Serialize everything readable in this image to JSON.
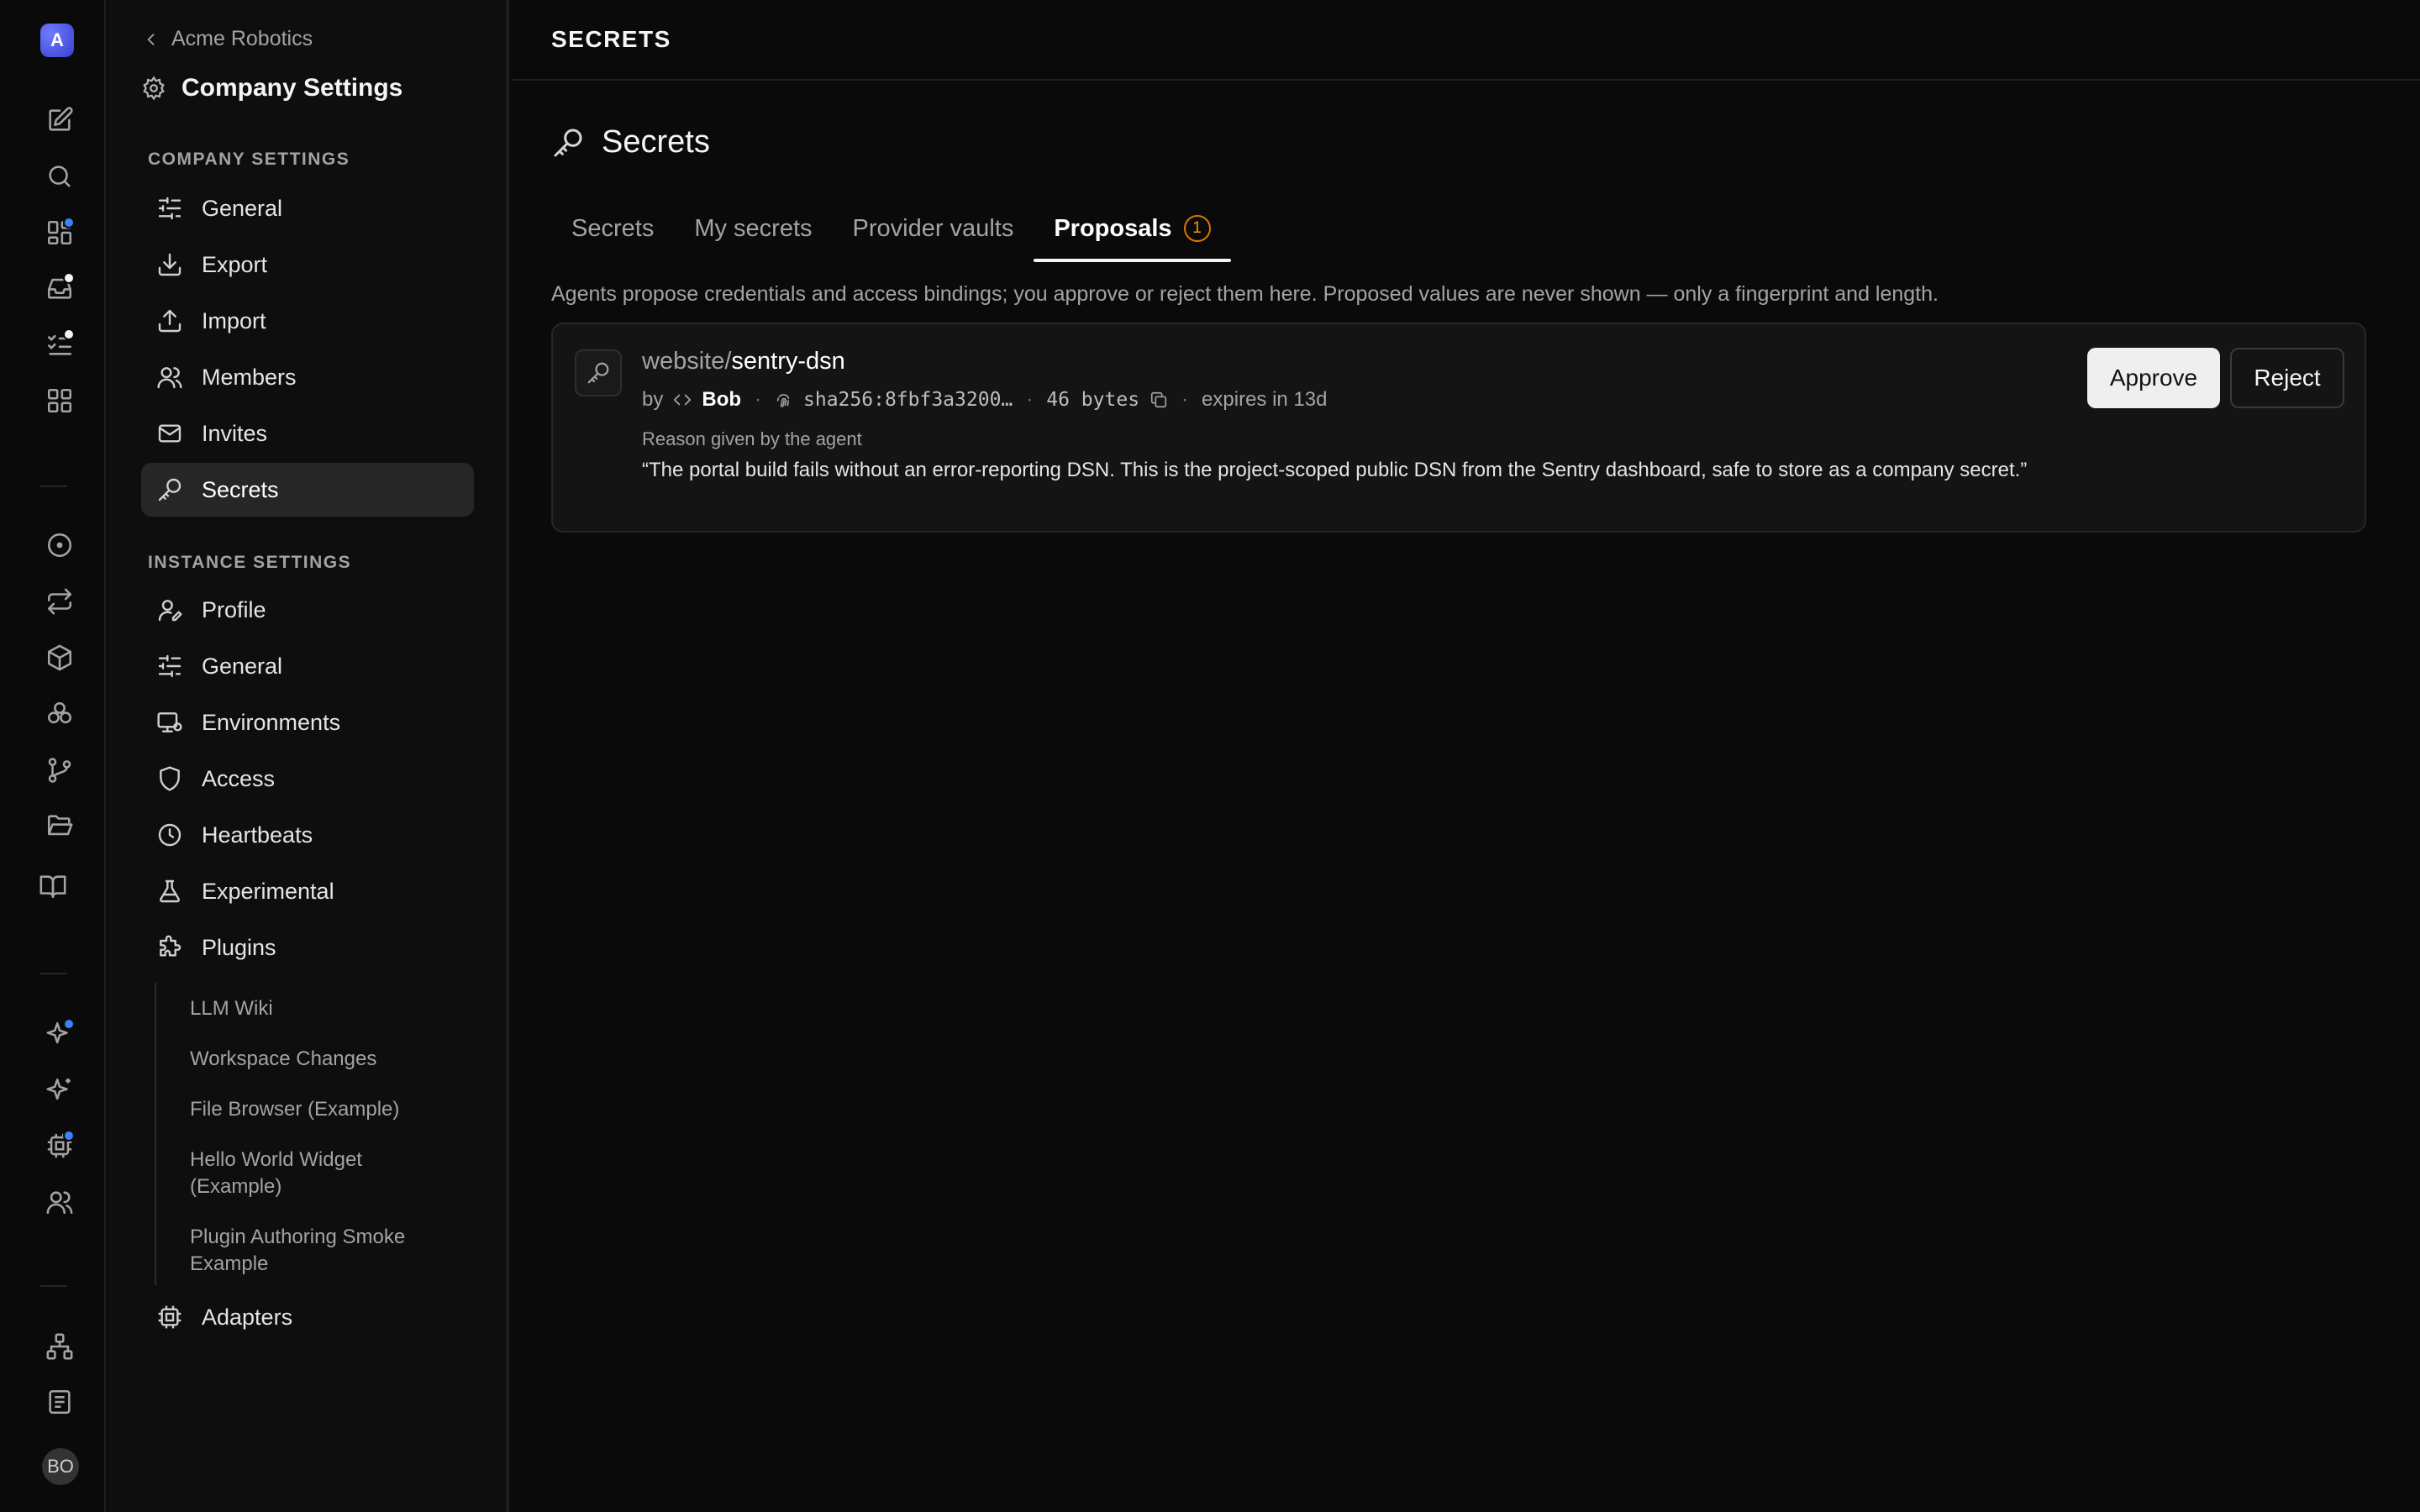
{
  "rail": {
    "logo_letter": "A",
    "avatar_initials": "BO"
  },
  "sidebar": {
    "back_label": "Acme Robotics",
    "title": "Company Settings",
    "company_heading": "COMPANY SETTINGS",
    "company_items": [
      {
        "label": "General",
        "icon": "sliders-icon"
      },
      {
        "label": "Export",
        "icon": "download-icon"
      },
      {
        "label": "Import",
        "icon": "upload-icon"
      },
      {
        "label": "Members",
        "icon": "users-icon"
      },
      {
        "label": "Invites",
        "icon": "mail-icon"
      },
      {
        "label": "Secrets",
        "icon": "key-icon",
        "active": true
      }
    ],
    "instance_heading": "INSTANCE SETTINGS",
    "instance_items": [
      {
        "label": "Profile",
        "icon": "user-pen-icon"
      },
      {
        "label": "General",
        "icon": "sliders-icon"
      },
      {
        "label": "Environments",
        "icon": "monitor-icon"
      },
      {
        "label": "Access",
        "icon": "shield-icon"
      },
      {
        "label": "Heartbeats",
        "icon": "clock-icon"
      },
      {
        "label": "Experimental",
        "icon": "flask-icon"
      },
      {
        "label": "Plugins",
        "icon": "puzzle-icon"
      }
    ],
    "plugin_items": [
      "LLM Wiki",
      "Workspace Changes",
      "File Browser (Example)",
      "Hello World Widget (Example)",
      "Plugin Authoring Smoke Example"
    ],
    "adapters_label": "Adapters"
  },
  "main": {
    "topbar_title": "SECRETS",
    "page_title": "Secrets",
    "tabs": [
      {
        "label": "Secrets"
      },
      {
        "label": "My secrets"
      },
      {
        "label": "Provider vaults"
      },
      {
        "label": "Proposals",
        "badge": "1",
        "active": true
      }
    ],
    "description": "Agents propose credentials and access bindings; you approve or reject them here. Proposed values are never shown — only a fingerprint and length.",
    "proposal": {
      "namespace": "website/",
      "name": "sentry-dsn",
      "by_label": "by",
      "agent": "Bob",
      "fingerprint": "sha256:8fbf3a3200…",
      "size": "46 bytes",
      "expires": "expires in 13d",
      "reason_label": "Reason given by the agent",
      "reason": "“The portal build fails without an error-reporting DSN. This is the project-scoped public DSN from the Sentry dashboard, safe to store as a company secret.”",
      "approve_label": "Approve",
      "reject_label": "Reject"
    }
  }
}
